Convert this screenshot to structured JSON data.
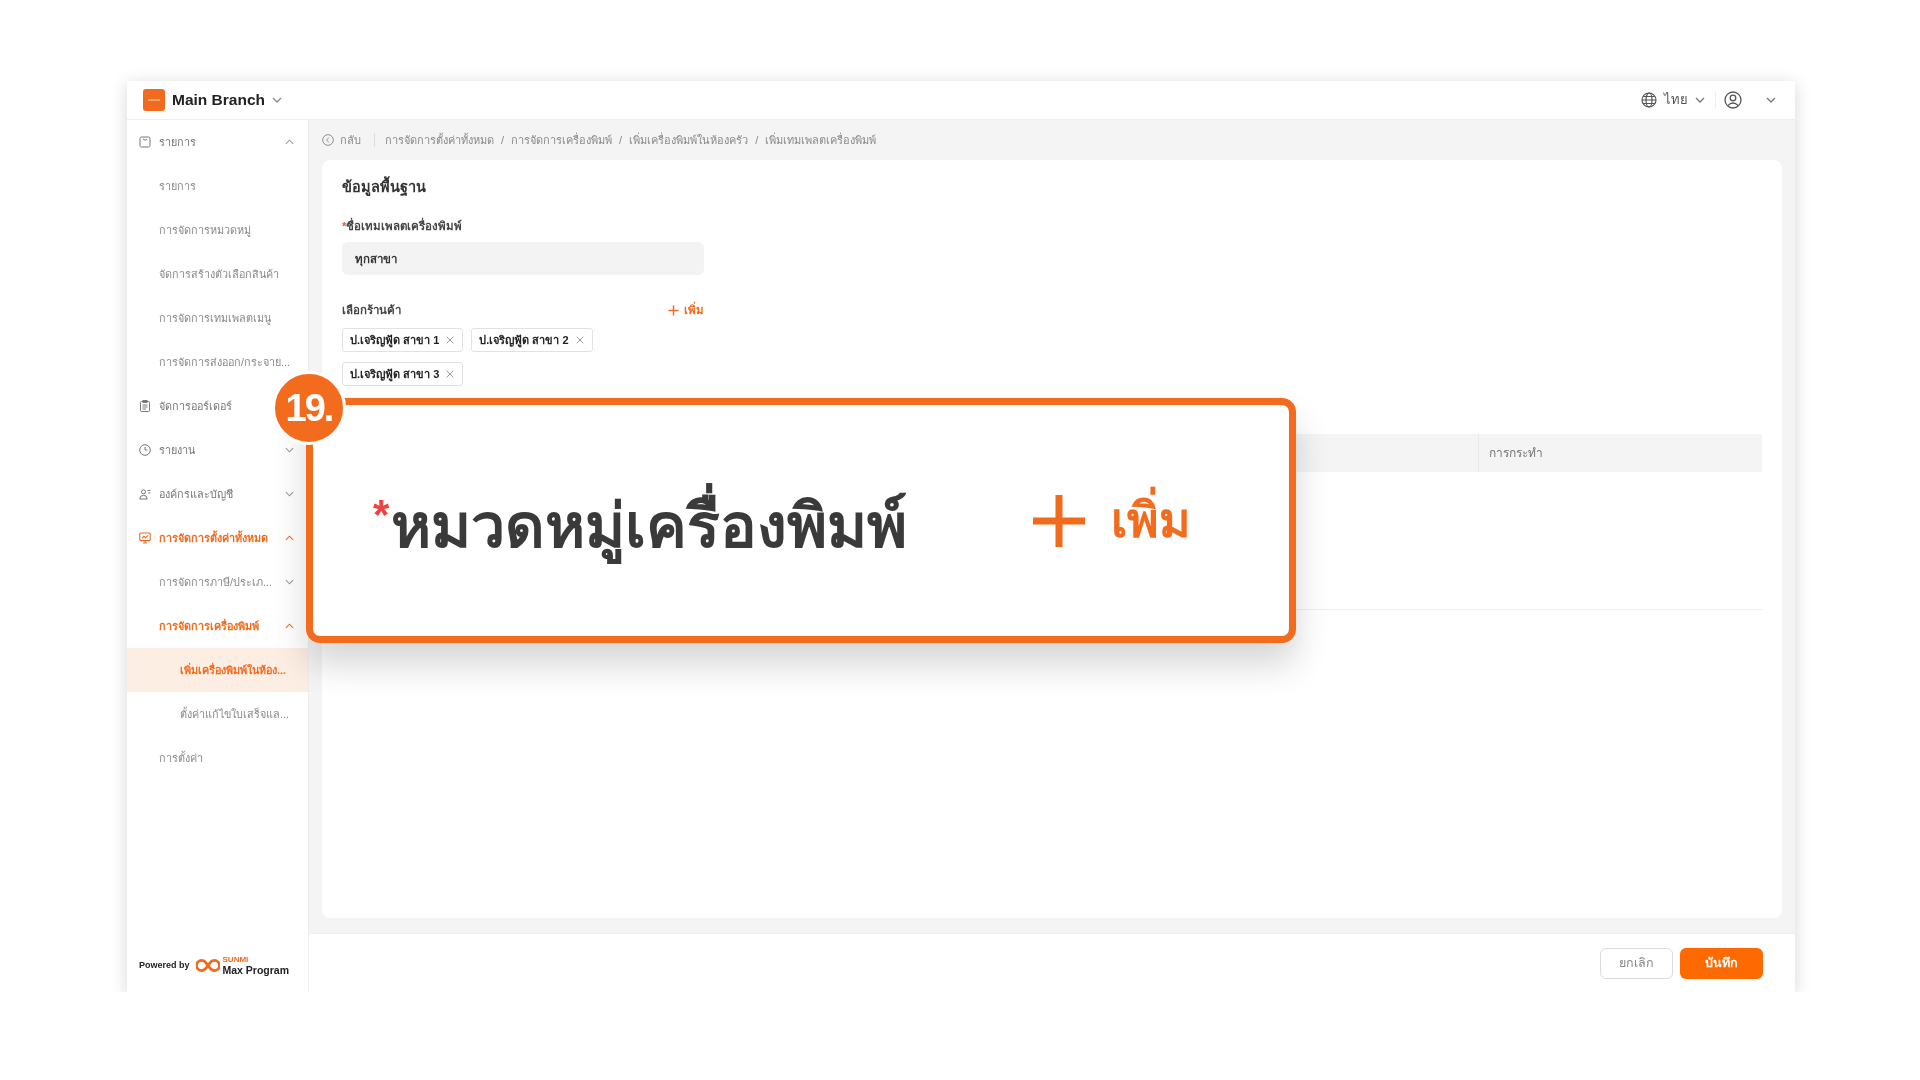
{
  "top_bar": {
    "branch": "Main Branch",
    "language": "ไทย"
  },
  "sidebar": {
    "items": [
      {
        "label": "รายการ",
        "selected": false,
        "expanded": true,
        "children": [
          {
            "label": "รายการ",
            "selected": false
          },
          {
            "label": "การจัดการหมวดหมู่",
            "selected": false
          },
          {
            "label": "จัดการสร้างตัวเลือกสินค้า",
            "selected": false
          },
          {
            "label": "การจัดการเทมเพลตเมนู",
            "selected": false
          },
          {
            "label": "การจัดการส่งออก/กระจาย...",
            "selected": false
          }
        ]
      },
      {
        "label": "จัดการออร์เดอร์",
        "selected": false
      },
      {
        "label": "รายงาน",
        "selected": false,
        "expanded": false
      },
      {
        "label": "องค์กรและบัญชี",
        "selected": false,
        "expanded": false
      },
      {
        "label": "การจัดการตั้งค่าทั้งหมด",
        "selected": false,
        "expanded": true,
        "children": [
          {
            "label": "การจัดการภาษี/ประเภ...",
            "selected": false,
            "expanded": false
          },
          {
            "label": "การจัดการเครื่องพิมพ์",
            "selected": false,
            "expanded": true,
            "children": [
              {
                "label": "เพิ่มเครื่องพิมพ์ในห้อง...",
                "selected": true
              },
              {
                "label": "ตั้งค่าแก้ไขใบเสร็จแล...",
                "selected": false
              }
            ]
          },
          {
            "label": "การตั้งค่า",
            "selected": false
          }
        ]
      }
    ],
    "powered_by": {
      "label": "Powered by",
      "brand_tag": "SUNMI",
      "brand": "Max Program"
    }
  },
  "breadcrumb": {
    "back": "กลับ",
    "separator": "/",
    "items": [
      "การจัดการตั้งค่าทั้งหมด",
      "การจัดการเครื่องพิมพ์",
      "เพิ่มเครื่องพิมพ์ในห้องครัว",
      "เพิ่มเทมเพลตเครื่องพิมพ์"
    ]
  },
  "form": {
    "title": "ข้อมูลพื้นฐาน",
    "template_name": {
      "required_mark": "*",
      "label": "ชื่อเทมเพลตเครื่องพิมพ์",
      "value": "ทุกสาขา"
    },
    "stores": {
      "label": "เลือกร้านค้า",
      "add_label": "เพิ่ม",
      "tags": [
        "ป.เจริญฟู้ด สาขา 1",
        "ป.เจริญฟู้ด สาขา 2",
        "ป.เจริญฟู้ด สาขา 3"
      ]
    }
  },
  "table": {
    "columns": [
      "การกระทำ"
    ]
  },
  "callout": {
    "number": "19.",
    "required_mark": "*",
    "label": "หมวดหมู่เครื่องพิมพ์",
    "add_label": "เพิ่ม"
  },
  "footer": {
    "buttons": [
      {
        "label": "ยกเลิก",
        "kind": "secondary"
      },
      {
        "label": "บันทึก",
        "kind": "primary"
      }
    ]
  }
}
